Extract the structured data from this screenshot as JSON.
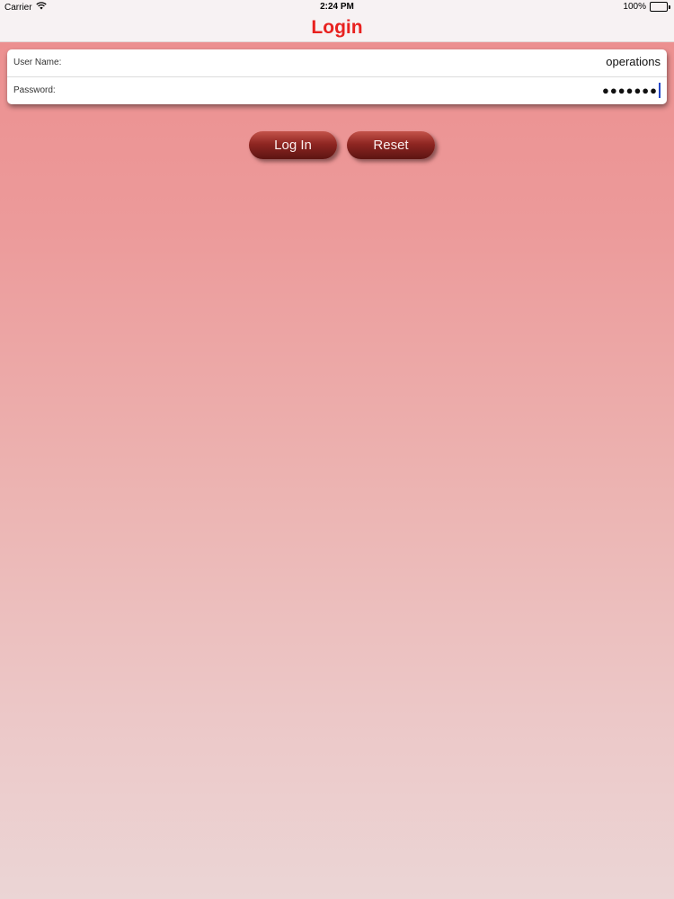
{
  "status_bar": {
    "carrier": "Carrier",
    "time": "2:24 PM",
    "battery": "100%"
  },
  "nav": {
    "title": "Login",
    "title_color": "#e8211f"
  },
  "form": {
    "username": {
      "label": "User Name:",
      "value": "operations"
    },
    "password": {
      "label": "Password:",
      "value": "●●●●●●●"
    }
  },
  "buttons": {
    "login_label": "Log In",
    "reset_label": "Reset",
    "color": "#8f2622"
  },
  "icons": {
    "wifi": "wifi-icon",
    "battery": "battery-icon"
  }
}
